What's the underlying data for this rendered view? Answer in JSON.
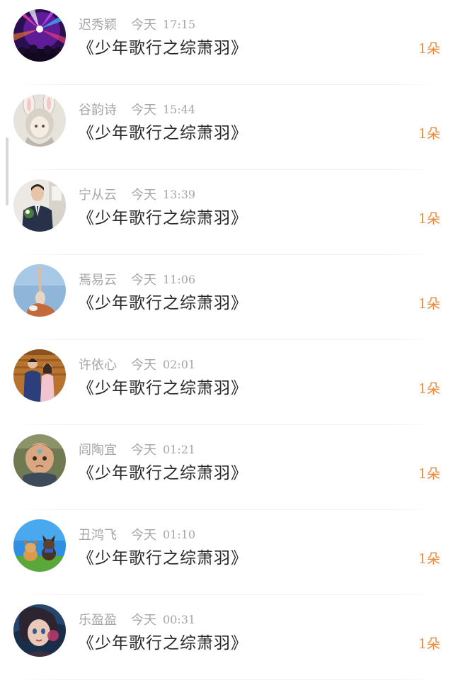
{
  "conversations": [
    {
      "name": "迟秀颖",
      "day": "今天",
      "time": "17:15",
      "title": "《少年歌行之综萧羽》",
      "count": "1朵",
      "avatar_icon": "disco-lights-avatar-icon"
    },
    {
      "name": "谷韵诗",
      "day": "今天",
      "time": "15:44",
      "title": "《少年歌行之综萧羽》",
      "count": "1朵",
      "avatar_icon": "bunny-ears-girl-avatar-icon"
    },
    {
      "name": "宁从云",
      "day": "今天",
      "time": "13:39",
      "title": "《少年歌行之综萧羽》",
      "count": "1朵",
      "avatar_icon": "man-in-suit-avatar-icon"
    },
    {
      "name": "焉易云",
      "day": "今天",
      "time": "11:06",
      "title": "《少年歌行之综萧羽》",
      "count": "1朵",
      "avatar_icon": "gymnast-sky-avatar-icon"
    },
    {
      "name": "许依心",
      "day": "今天",
      "time": "02:01",
      "title": "《少年歌行之综萧羽》",
      "count": "1朵",
      "avatar_icon": "couple-photo-avatar-icon"
    },
    {
      "name": "闾陶宜",
      "day": "今天",
      "time": "01:21",
      "title": "《少年歌行之综萧羽》",
      "count": "1朵",
      "avatar_icon": "toddler-avatar-icon"
    },
    {
      "name": "丑鸿飞",
      "day": "今天",
      "time": "01:10",
      "title": "《少年歌行之综萧羽》",
      "count": "1朵",
      "avatar_icon": "cartoon-dogs-avatar-icon"
    },
    {
      "name": "乐盈盈",
      "day": "今天",
      "time": "00:31",
      "title": "《少年歌行之综萧羽》",
      "count": "1朵",
      "avatar_icon": "anime-girl-avatar-icon"
    }
  ],
  "colors": {
    "meta_text": "#a6a6a6",
    "title_text": "#262626",
    "count_accent": "#e8893c",
    "divider": "#eeeeee"
  }
}
